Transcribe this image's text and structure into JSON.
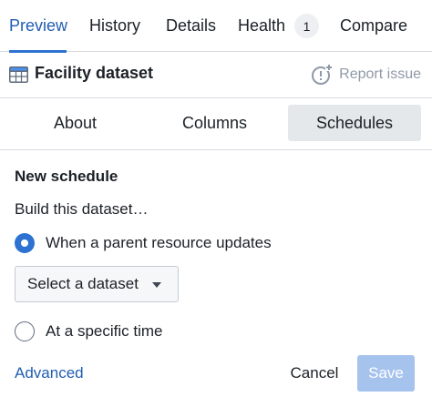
{
  "tabs": [
    {
      "label": "Preview",
      "active": true
    },
    {
      "label": "History"
    },
    {
      "label": "Details"
    },
    {
      "label": "Health",
      "badge": "1"
    },
    {
      "label": "Compare"
    }
  ],
  "header": {
    "title": "Facility dataset",
    "icon": "table-icon",
    "report_label": "Report issue",
    "report_icon": "report-issue-icon"
  },
  "subtabs": [
    {
      "label": "About"
    },
    {
      "label": "Columns"
    },
    {
      "label": "Schedules",
      "active": true
    }
  ],
  "schedule": {
    "title": "New schedule",
    "lead": "Build this dataset…",
    "option_parent": {
      "label": "When a parent resource updates",
      "checked": true
    },
    "select": {
      "value": "Select a dataset"
    },
    "option_time": {
      "label": "At a specific time",
      "checked": false
    }
  },
  "footer": {
    "advanced_label": "Advanced",
    "cancel_label": "Cancel",
    "save_label": "Save",
    "save_disabled": true
  },
  "colors": {
    "accent": "#2d72d2",
    "link": "#215db0",
    "save_disabled": "#a6c3ee",
    "muted": "#8f99a8"
  }
}
